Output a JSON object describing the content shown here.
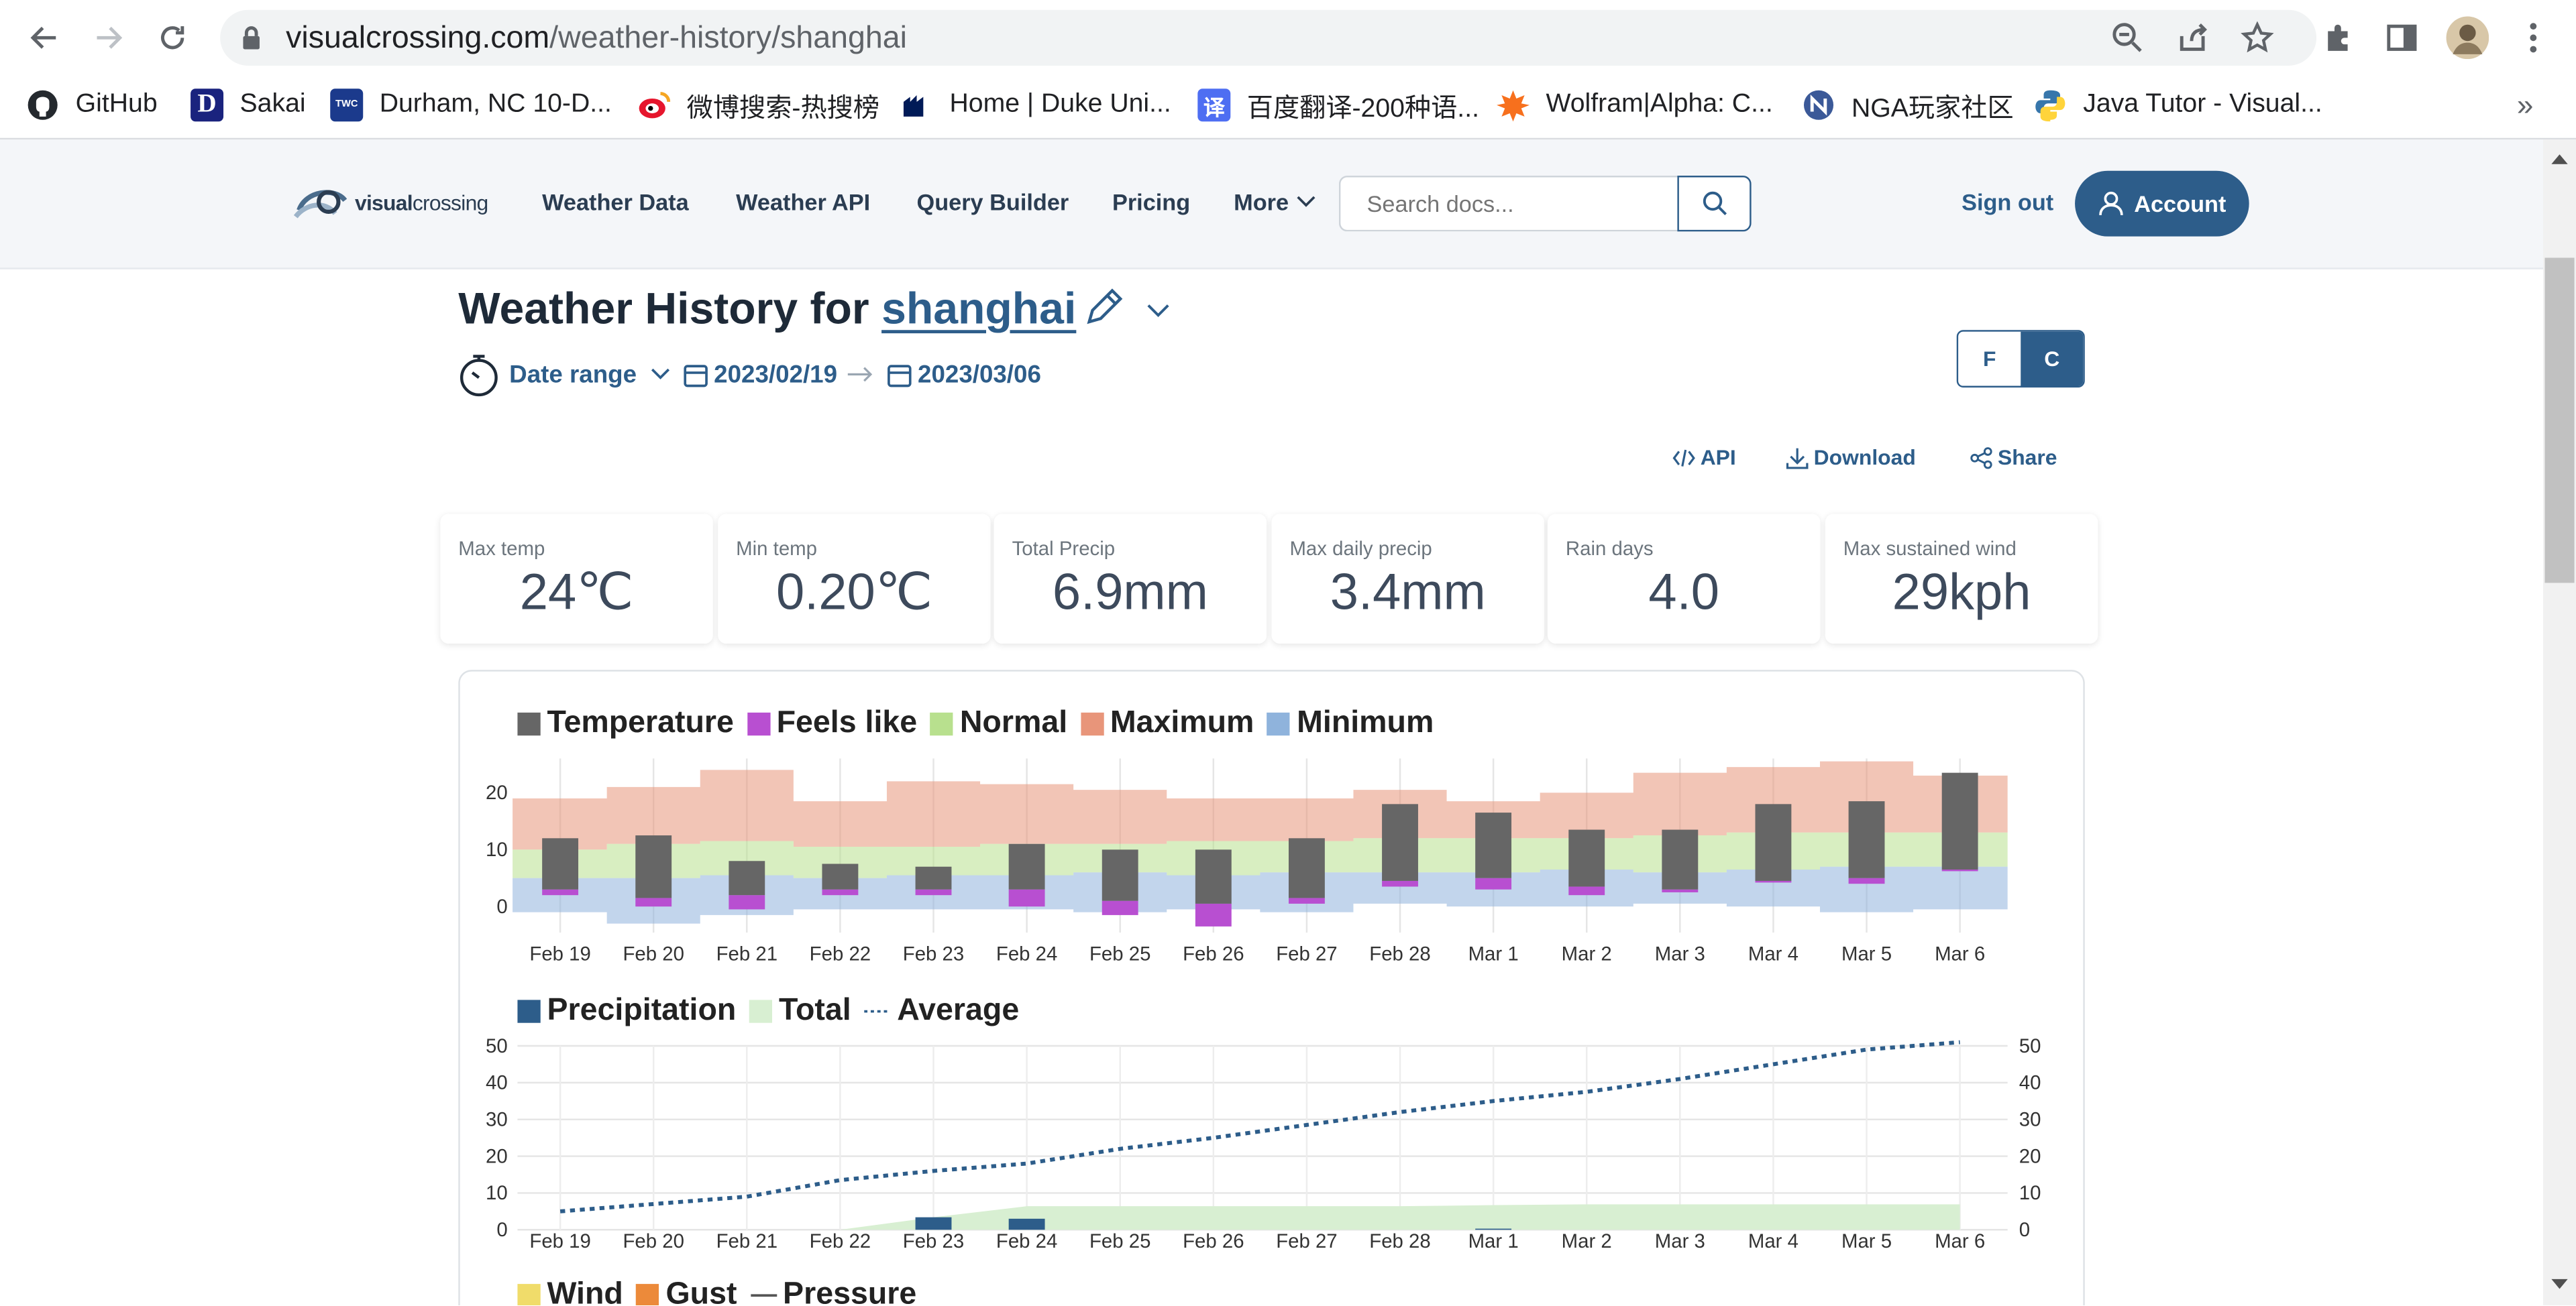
{
  "browser": {
    "url_domain": "visualcrossing.com",
    "url_path": "/weather-history/shanghai",
    "bookmarks": [
      {
        "label": "GitHub",
        "icon": "github-icon",
        "color": "#24292e"
      },
      {
        "label": "Sakai",
        "icon": "sakai-d-icon",
        "color": "#1a237e"
      },
      {
        "label": "Durham, NC 10-D...",
        "icon": "weather-channel-icon",
        "color": "#1b3a8c"
      },
      {
        "label": "微博搜索-热搜榜",
        "icon": "weibo-icon",
        "color": "#e6162d"
      },
      {
        "label": "Home | Duke Uni...",
        "icon": "duke-icon",
        "color": "#001a57"
      },
      {
        "label": "百度翻译-200种语...",
        "icon": "baidu-translate-icon",
        "color": "#4e6ef2"
      },
      {
        "label": "Wolfram|Alpha: C...",
        "icon": "wolfram-icon",
        "color": "#dd1100"
      },
      {
        "label": "NGA玩家社区",
        "icon": "nga-icon",
        "color": "#3b5998"
      },
      {
        "label": "Java Tutor - Visual...",
        "icon": "python-icon",
        "color": "#3776ab"
      }
    ]
  },
  "site": {
    "logo_bold": "visual",
    "logo_light": "crossing",
    "nav": [
      "Weather Data",
      "Weather API",
      "Query Builder",
      "Pricing",
      "More"
    ],
    "search_placeholder": "Search docs...",
    "sign_out": "Sign out",
    "account": "Account",
    "colors": {
      "primary": "#2d5d8a",
      "text": "#2b3d52"
    }
  },
  "page": {
    "title_prefix": "Weather History for",
    "location": "shanghai",
    "date_range_label": "Date range",
    "start_date": "2023/02/19",
    "end_date": "2023/03/06",
    "unit_f": "F",
    "unit_c": "C",
    "actions": {
      "api": "API",
      "download": "Download",
      "share": "Share"
    }
  },
  "stats": [
    {
      "label": "Max temp",
      "value": "24℃"
    },
    {
      "label": "Min temp",
      "value": "0.20℃"
    },
    {
      "label": "Total Precip",
      "value": "6.9mm"
    },
    {
      "label": "Max daily precip",
      "value": "3.4mm"
    },
    {
      "label": "Rain days",
      "value": "4.0"
    },
    {
      "label": "Max sustained wind",
      "value": "29kph"
    }
  ],
  "chart_data": [
    {
      "type": "bar",
      "legend": [
        {
          "name": "Temperature",
          "color": "#666666"
        },
        {
          "name": "Feels like",
          "color": "#b84fd1"
        },
        {
          "name": "Normal",
          "color": "#b8e08e"
        },
        {
          "name": "Maximum",
          "color": "#e8957a"
        },
        {
          "name": "Minimum",
          "color": "#8fb3dc"
        }
      ],
      "categories": [
        "Feb 19",
        "Feb 20",
        "Feb 21",
        "Feb 22",
        "Feb 23",
        "Feb 24",
        "Feb 25",
        "Feb 26",
        "Feb 27",
        "Feb 28",
        "Mar 1",
        "Mar 2",
        "Mar 3",
        "Mar 4",
        "Mar 5",
        "Mar 6"
      ],
      "ylim": [
        -4,
        26
      ],
      "yticks": [
        0,
        10,
        20
      ],
      "temp_max": [
        12,
        12.5,
        8,
        7.5,
        7,
        11,
        10,
        10,
        12,
        18,
        16.5,
        13.5,
        13.5,
        18,
        18.5,
        23.5
      ],
      "temp_min": [
        3,
        1.5,
        2,
        3,
        3,
        3,
        1,
        0.5,
        1.5,
        4.5,
        5,
        3.5,
        3,
        4.5,
        5,
        6.5
      ],
      "feels_min": [
        2,
        0,
        -0.5,
        2,
        2,
        0,
        -1.5,
        -3.5,
        0.5,
        3.5,
        3,
        2,
        2.5,
        4.5,
        4,
        6.5
      ],
      "band_maximum": [
        19,
        21,
        24,
        18.5,
        22,
        21.5,
        20.5,
        19,
        19,
        20.5,
        18.5,
        20,
        23.5,
        24.5,
        25.5,
        23
      ],
      "band_normal_top": [
        10,
        11,
        11.5,
        10.5,
        10.5,
        11,
        11,
        11.5,
        11.5,
        12,
        12,
        12,
        12.5,
        13,
        13,
        13
      ],
      "band_normal_bottom": [
        5,
        5,
        5.5,
        5,
        5.5,
        5.5,
        6,
        5.5,
        6,
        6,
        6,
        6.5,
        6,
        6.5,
        7,
        7
      ],
      "band_minimum_bottom": [
        -1,
        -3,
        -1.5,
        -0.5,
        -0.5,
        -0.5,
        -1,
        -0.5,
        -1,
        0.5,
        0,
        0,
        0.5,
        0,
        -1,
        -0.5
      ]
    },
    {
      "type": "bar",
      "legend": [
        {
          "name": "Precipitation",
          "color": "#2d5d8a"
        },
        {
          "name": "Total",
          "color": "#d8efd2"
        },
        {
          "name": "Average",
          "color": "#2d5d8a"
        }
      ],
      "categories": [
        "Feb 19",
        "Feb 20",
        "Feb 21",
        "Feb 22",
        "Feb 23",
        "Feb 24",
        "Feb 25",
        "Feb 26",
        "Feb 27",
        "Feb 28",
        "Mar 1",
        "Mar 2",
        "Mar 3",
        "Mar 4",
        "Mar 5",
        "Mar 6"
      ],
      "ylim": [
        0,
        50
      ],
      "yticks": [
        0,
        10,
        20,
        30,
        40,
        50
      ],
      "precipitation": [
        0,
        0,
        0,
        0,
        3.4,
        3.0,
        0,
        0,
        0,
        0,
        0.3,
        0,
        0,
        0,
        0,
        0
      ],
      "total": [
        0,
        0,
        0,
        0,
        3.4,
        6.4,
        6.4,
        6.4,
        6.4,
        6.4,
        6.7,
        6.9,
        6.9,
        6.9,
        6.9,
        6.9
      ],
      "average": [
        5,
        7,
        9,
        13.5,
        16,
        18,
        22,
        25,
        28.5,
        32,
        35,
        37.5,
        41,
        45,
        49,
        51
      ]
    }
  ],
  "wind_legend": [
    {
      "name": "Wind",
      "color": "#f0dc6a"
    },
    {
      "name": "Gust",
      "color": "#ec8a3a"
    },
    {
      "name": "Pressure",
      "color": "#555555"
    }
  ]
}
